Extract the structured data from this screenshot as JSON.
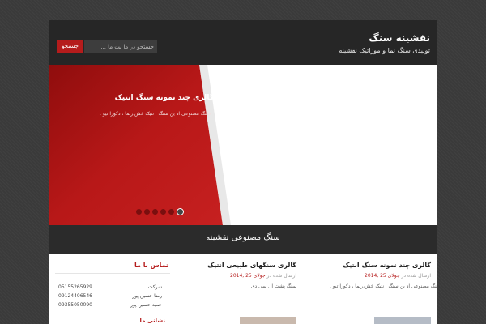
{
  "header": {
    "site_title": "نقشینه سنگ",
    "site_description": "تولیدی سنگ نما و موزائیک نقشینه",
    "search_button": "جستجو",
    "search_placeholder": "جستجو در ما بت ما ..."
  },
  "slider": {
    "title": "گالری چند نمونه سنگ انتیک",
    "text": "سنگ مصنوعی اد ین سنگ ا نتیک خش،رنما ، دکورا تیو .",
    "slide_count": 6,
    "active_index": 5,
    "accent_color": "#b51c1c"
  },
  "banner": {
    "title": "سنگ مصنوعی نقشینه"
  },
  "posts": [
    {
      "title": "گالری چند نمونه سنگ انتیک",
      "meta_prefix": "ارسال شده در",
      "date": "جولای 25 ,2014",
      "excerpt": "سنگ مصنوعی اد ین سنگ ا نتیک خش،رنما ، دکورا تیو ."
    },
    {
      "title": "گالری سنگهای طبیعی انتیک",
      "meta_prefix": "ارسال شده در",
      "date": "جولای 25 ,2014",
      "excerpt": "سنگ پشت ال سی دی"
    }
  ],
  "contact": {
    "title": "تماس با ما",
    "rows": [
      {
        "label": "شرکت",
        "number": "05155265929"
      },
      {
        "label": "رضا حسین پور",
        "number": "09124406546"
      },
      {
        "label": "حمید حسین پور",
        "number": "09355050090"
      }
    ],
    "subtitle": "نشانی ما"
  }
}
